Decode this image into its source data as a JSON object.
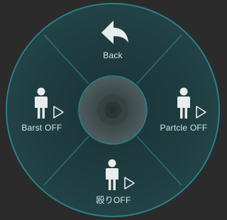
{
  "menu": {
    "back": {
      "label": "Back",
      "icon": "back-arrow-icon"
    },
    "left": {
      "label": "Barst OFF",
      "icon": "person-play-icon"
    },
    "right": {
      "label": "Partcle OFF",
      "icon": "person-play-icon"
    },
    "bottom": {
      "label": "殴りOFF",
      "icon": "person-play-icon"
    },
    "center": {
      "icon": "center-hub-icon"
    }
  },
  "colors": {
    "background": "#2b2b2b",
    "wheel_fill": "#1f3c40",
    "wheel_border": "#2a7f86",
    "divider": "#2b6e74",
    "hub": "#4a5a5c",
    "icon": "#e9ecec"
  }
}
